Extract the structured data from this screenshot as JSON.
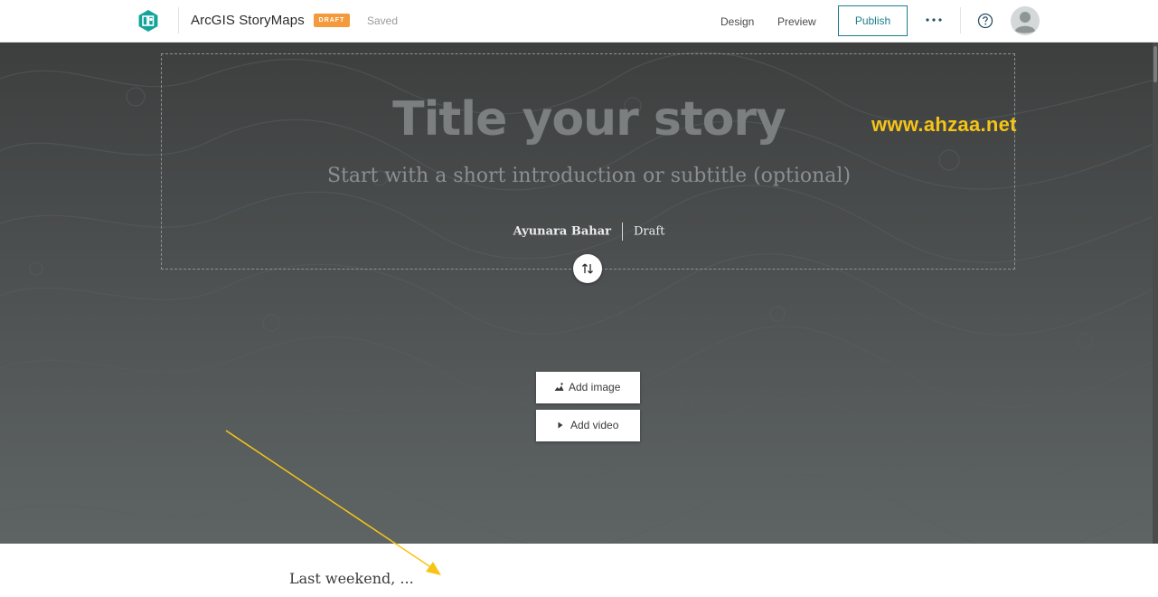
{
  "topbar": {
    "app_name": "ArcGIS StoryMaps",
    "status_badge": "DRAFT",
    "save_status": "Saved",
    "nav": {
      "design": "Design",
      "preview": "Preview"
    },
    "publish_label": "Publish",
    "more_icon": "ellipsis-icon",
    "help_icon": "question-circle-icon",
    "avatar_icon": "user-avatar-icon",
    "brand_color": "#12a39a",
    "accent_color": "#1b7f8c",
    "badge_color": "#f59a3c"
  },
  "cover": {
    "title_placeholder": "Title your story",
    "subtitle_placeholder": "Start with a short introduction or subtitle (optional)",
    "author": "Ayunara Bahar",
    "byline_status": "Draft",
    "swap_icon": "swap-vertical-icon",
    "media_buttons": {
      "add_image": "Add image",
      "add_video": "Add video"
    },
    "watermark": "www.ahzaa.net",
    "watermark_color": "#f6c416"
  },
  "body": {
    "first_paragraph": "Last weekend, ..."
  }
}
